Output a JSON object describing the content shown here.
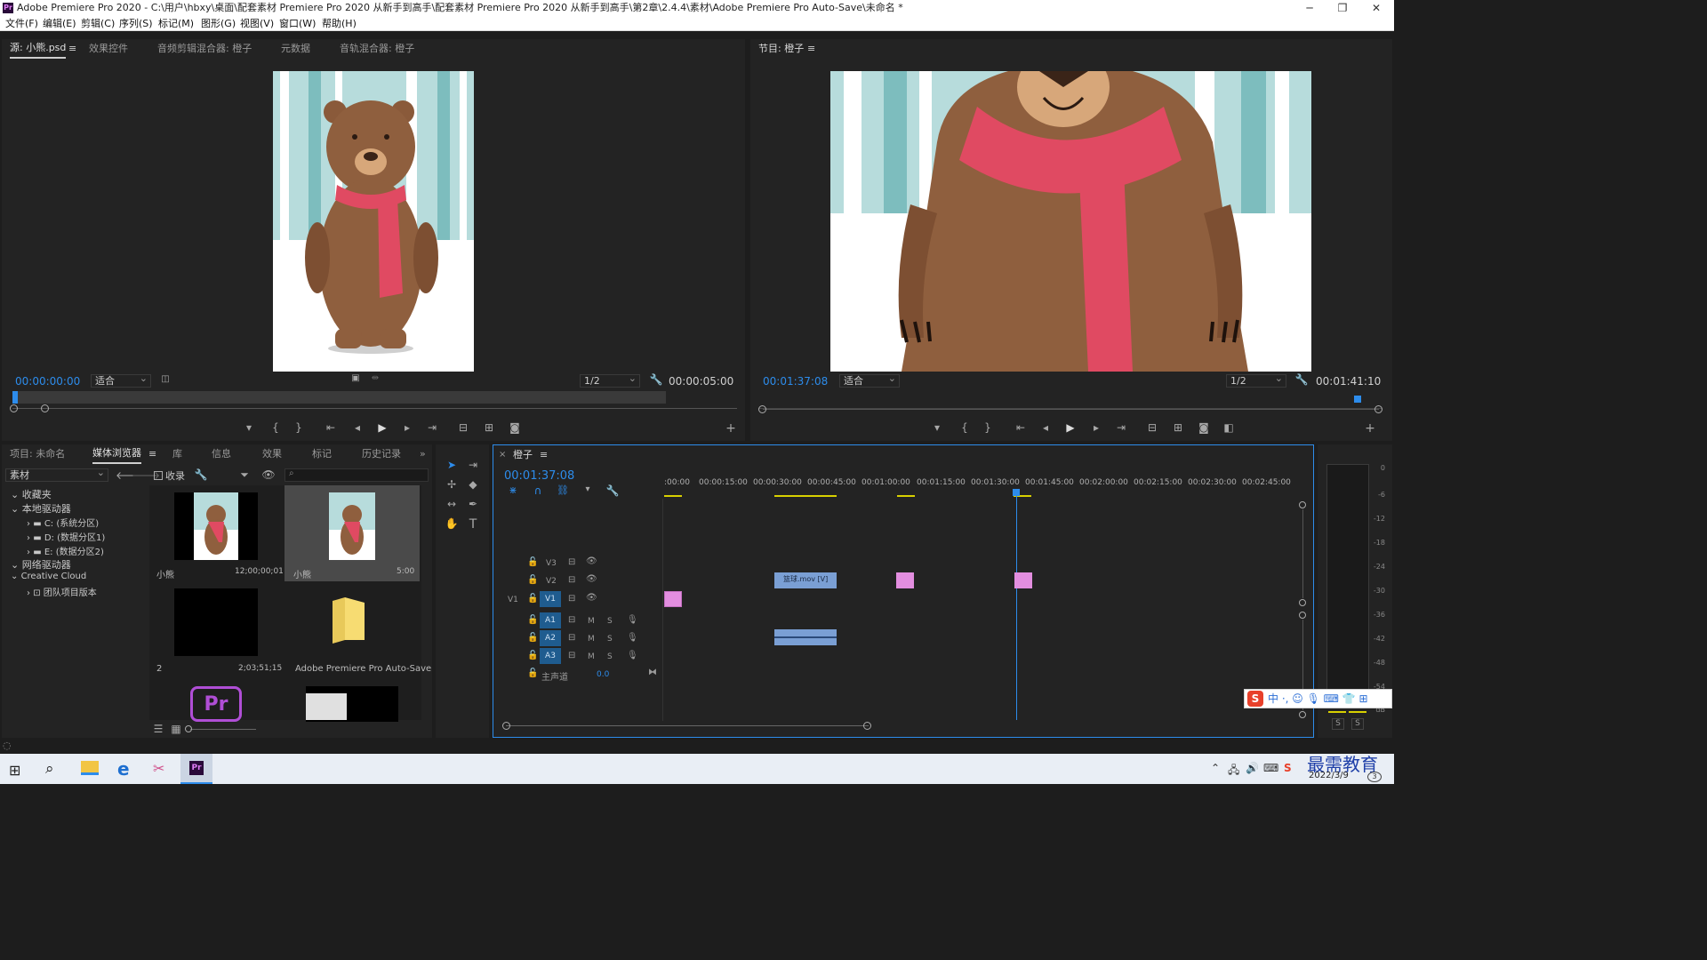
{
  "window": {
    "title": "Adobe Premiere Pro 2020 - C:\\用户\\hbxy\\桌面\\配套素材 Premiere Pro 2020 从新手到高手\\配套素材 Premiere Pro 2020 从新手到高手\\第2章\\2.4.4\\素材\\Adobe Premiere Pro Auto-Save\\未命名 *",
    "app_icon": "Pr"
  },
  "menu": [
    "文件(F)",
    "编辑(E)",
    "剪辑(C)",
    "序列(S)",
    "标记(M)",
    "图形(G)",
    "视图(V)",
    "窗口(W)",
    "帮助(H)"
  ],
  "source_panel": {
    "tabs": [
      "源: 小熊.psd",
      "效果控件",
      "音频剪辑混合器: 橙子",
      "元数据",
      "音轨混合器: 橙子"
    ],
    "timecode": "00:00:00:00",
    "fit": "适合",
    "resolution": "1/2",
    "duration": "00:00:05:00",
    "playhead_fraction": 0.0
  },
  "program_panel": {
    "tab": "节目: 橙子",
    "timecode": "00:01:37:08",
    "fit": "适合",
    "resolution": "1/2",
    "duration": "00:01:41:10",
    "playhead_fraction": 0.96
  },
  "project_panel": {
    "tabs": [
      "项目: 未命名",
      "媒体浏览器",
      "库",
      "信息",
      "效果",
      "标记",
      "历史记录"
    ],
    "source_select": "素材",
    "ingest_label": "收录",
    "tree": [
      "收藏夹",
      "本地驱动器",
      "C: (系统分区)",
      "D: (数据分区1)",
      "E: (数据分区2)",
      "网络驱动器",
      "Creative Cloud",
      "团队项目版本"
    ],
    "items": [
      {
        "name": "小熊",
        "duration": "12;00;00;01"
      },
      {
        "name": "小熊",
        "duration": "5:00"
      },
      {
        "name": "2",
        "duration": "2;03;51;15"
      },
      {
        "name": "Adobe Premiere Pro Auto-Save",
        "duration": ""
      },
      {
        "name": "Pr",
        "duration": ""
      },
      {
        "name": "",
        "duration": ""
      }
    ]
  },
  "timeline": {
    "tab": "橙子",
    "timecode": "00:01:37:08",
    "ruler": [
      ":00:00",
      "00:00:15:00",
      "00:00:30:00",
      "00:00:45:00",
      "00:01:00:00",
      "00:01:15:00",
      "00:01:30:00",
      "00:01:45:00",
      "00:02:00:00",
      "00:02:15:00",
      "00:02:30:00",
      "00:02:45:00"
    ],
    "tracks": {
      "v3": "V3",
      "v2": "V2",
      "v1": "V1",
      "v1_src": "V1",
      "a1": "A1",
      "a2": "A2",
      "a3": "A3",
      "m": "M",
      "s": "S",
      "master_label": "主声道",
      "master_value": "0.0"
    },
    "clip_v2_label": "篮球.mov [V]"
  },
  "audio_meter": {
    "labels": [
      "0",
      "-6",
      "-12",
      "-18",
      "-24",
      "-30",
      "-36",
      "-42",
      "-48",
      "-54",
      "dB"
    ],
    "solo": [
      "S",
      "S"
    ]
  },
  "ime_bar": {
    "text": "中 ·, ☺ 🎙 ⌨ 👕 ⊞"
  },
  "taskbar": {
    "date": "2022/3/9",
    "watermark": "最需教育"
  },
  "colors": {
    "accent_blue": "#2d8ceb",
    "clip_pink": "#e38ee0",
    "clip_blue": "#7a9fd4",
    "track_blue": "#1f5c8f"
  }
}
